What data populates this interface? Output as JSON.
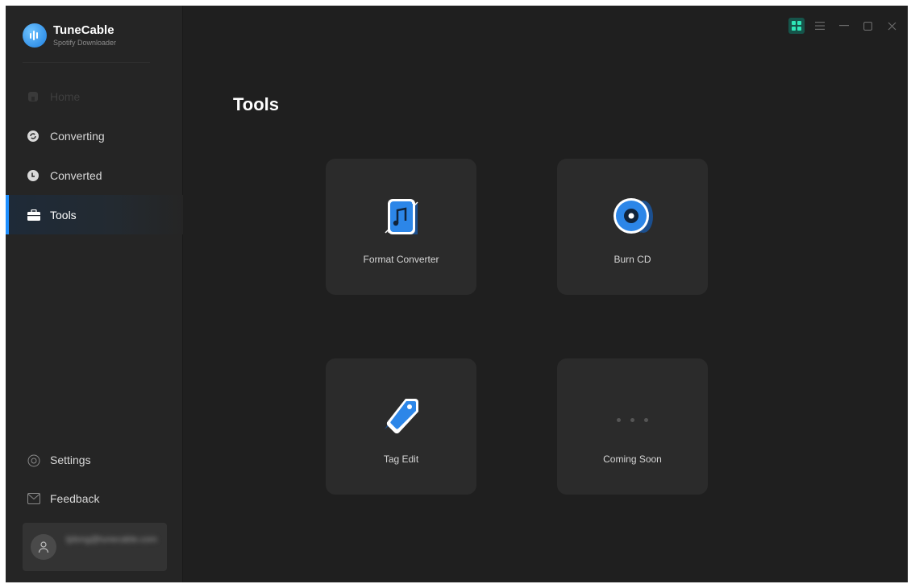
{
  "app": {
    "name": "TuneCable",
    "subtitle": "Spotify Downloader"
  },
  "sidebar": {
    "items": [
      {
        "label": "Home",
        "icon": "home-icon"
      },
      {
        "label": "Converting",
        "icon": "sync-icon"
      },
      {
        "label": "Converted",
        "icon": "clock-icon"
      },
      {
        "label": "Tools",
        "icon": "toolbox-icon"
      }
    ],
    "bottom_items": [
      {
        "label": "Settings",
        "icon": "settings-icon"
      },
      {
        "label": "Feedback",
        "icon": "mail-icon"
      }
    ],
    "user": {
      "email": "tjdong@tunecable.com",
      "icon": "user-avatar-icon"
    }
  },
  "main": {
    "title": "Tools",
    "tools": [
      {
        "label": "Format Converter",
        "icon": "format-converter-icon"
      },
      {
        "label": "Burn CD",
        "icon": "burn-cd-icon"
      },
      {
        "label": "Tag Edit",
        "icon": "tag-edit-icon"
      },
      {
        "label": "Coming Soon",
        "icon": "more-dots-icon"
      }
    ]
  },
  "colors": {
    "accent": "#1e8fff",
    "background": "#1f1f1f",
    "sidebar": "#252525",
    "card": "#2b2b2b"
  }
}
